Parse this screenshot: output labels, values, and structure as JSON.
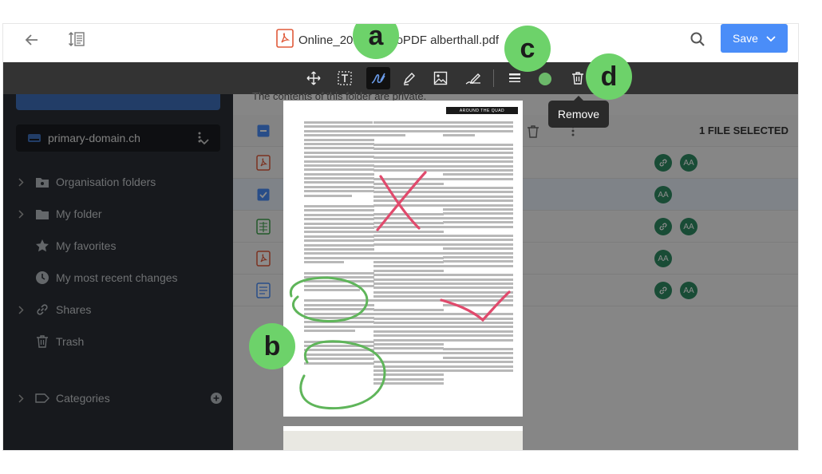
{
  "header": {
    "file_title": "Online_2019_demoPDF alberthall.pdf",
    "save_label": "Save"
  },
  "toolbar": {
    "tools": [
      "move-icon",
      "text-select-icon",
      "freehand-pen-icon",
      "highlighter-icon",
      "image-icon",
      "signature-icon",
      "line-weight-icon",
      "color-picker",
      "trash-icon"
    ],
    "active_tool": "freehand-pen-icon",
    "stroke_color": "#6cb96a",
    "tooltip": "Remove"
  },
  "sidebar": {
    "domain": "primary-domain.ch",
    "items": [
      {
        "label": "Organisation folders",
        "icon": "org-folder-icon",
        "expandable": true
      },
      {
        "label": "My folder",
        "icon": "folder-icon",
        "expandable": true
      },
      {
        "label": "My favorites",
        "icon": "star-icon",
        "expandable": false
      },
      {
        "label": "My most recent changes",
        "icon": "clock-icon",
        "expandable": false
      },
      {
        "label": "Shares",
        "icon": "link-icon",
        "expandable": true
      },
      {
        "label": "Trash",
        "icon": "trash-icon",
        "expandable": false
      },
      {
        "label": "Categories",
        "icon": "tag-icon",
        "expandable": true
      }
    ]
  },
  "filelist": {
    "notice": "The contents of this folder are private.",
    "selected_count": "1 FILE SELECTED",
    "rows": [
      {
        "type": "pdf",
        "share": true,
        "avatar": "AA"
      },
      {
        "type": "checked",
        "share": false,
        "avatar": "AA"
      },
      {
        "type": "sheet",
        "share": true,
        "avatar": "AA"
      },
      {
        "type": "pdf",
        "share": false,
        "avatar": "AA"
      },
      {
        "type": "doc",
        "share": true,
        "avatar": "AA"
      }
    ]
  },
  "document": {
    "header_text": "AROUND THE QUAD"
  },
  "callouts": [
    "a",
    "b",
    "c",
    "d"
  ],
  "colors": {
    "accent": "#4a8df8",
    "callout": "#6dd26a",
    "annotation_red": "#e04a6c",
    "annotation_green": "#5fb55a"
  }
}
